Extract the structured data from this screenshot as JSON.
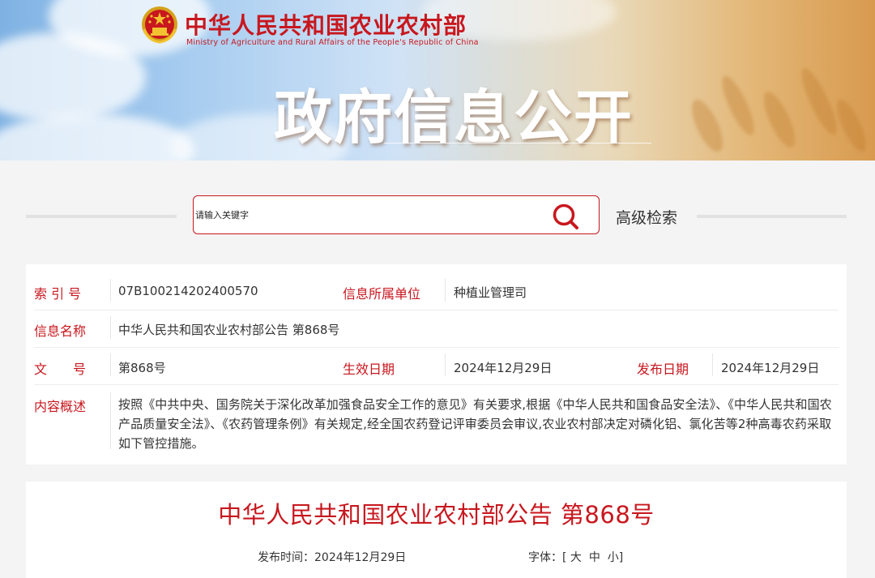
{
  "header": {
    "site_name": "中华人民共和国农业农村部",
    "site_name_en": "Ministry of Agriculture and Rural Affairs of the People's Republic of China",
    "banner_title": "政府信息公开"
  },
  "search": {
    "placeholder": "请输入关键字",
    "advanced_label": "高级检索",
    "icon": "search-icon"
  },
  "meta": {
    "index_label": "索 引 号",
    "index_value": "07B100214202400570",
    "dept_label": "信息所属单位",
    "dept_value": "种植业管理司",
    "name_label": "信息名称",
    "name_value": "中华人民共和国农业农村部公告 第868号",
    "doc_label": "文　　号",
    "doc_value": "第868号",
    "effective_label": "生效日期",
    "effective_value": "2024年12月29日",
    "publish_label": "发布日期",
    "publish_value": "2024年12月29日",
    "summary_label": "内容概述",
    "summary_value": "按照《中共中央、国务院关于深化改革加强食品安全工作的意见》有关要求,根据《中华人民共和国食品安全法》、《中华人民共和国农产品质量安全法》、《农药管理条例》有关规定,经全国农药登记评审委员会审议,农业农村部决定对磷化铝、氯化苦等2种高毒农药采取如下管控措施。"
  },
  "article": {
    "title": "中华人民共和国农业农村部公告 第868号",
    "publish_time_label": "发布时间：",
    "publish_time_value": "2024年12月29日",
    "font_label": "字体：",
    "bracket_open": "[",
    "font_large": "大",
    "font_medium": "中",
    "font_small": "小",
    "bracket_close": "]"
  },
  "colors": {
    "accent_red": "#c8171e",
    "background": "#f4f4f4"
  }
}
